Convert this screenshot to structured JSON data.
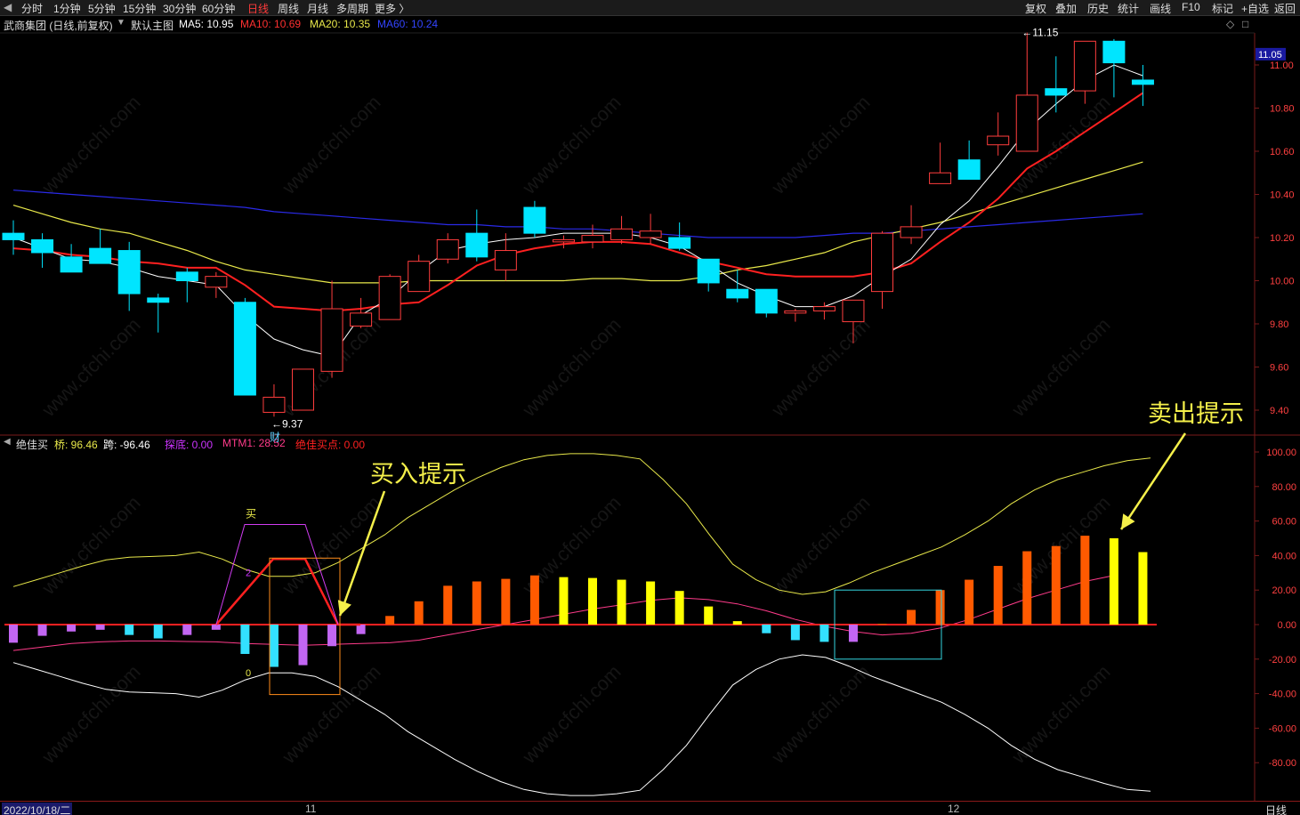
{
  "toolbar": {
    "periods": [
      "分时",
      "1分钟",
      "5分钟",
      "15分钟",
      "30分钟",
      "60分钟",
      "日线",
      "周线",
      "月线",
      "多周期",
      "更多 〉"
    ],
    "active_period": "日线",
    "right_buttons": [
      "复权",
      "叠加",
      "历史",
      "统计",
      "画线",
      "F10",
      "标记",
      "+自选",
      "返回"
    ]
  },
  "main_info": {
    "stock_name": "武商集团 (日线,前复权)",
    "template": "默认主图",
    "ma5": "MA5: 10.95",
    "ma10": "MA10: 10.69",
    "ma20": "MA20: 10.35",
    "ma60": "MA60: 10.24"
  },
  "indicator_info": {
    "name": "绝佳买",
    "qiao": "桥: 96.46",
    "kua": "跨: -96.46",
    "tandi": "探底: 0.00",
    "mtm1": "MTM1: 28.52",
    "buy_point": "绝佳买点: 0.00"
  },
  "annotations": {
    "buy_hint": "买入提示",
    "sell_hint": "卖出提示",
    "cai": "财",
    "low_label": "←9.37",
    "high_label": "←11.15",
    "mai_label": "买",
    "two_label": "2",
    "zero_label": "0"
  },
  "bottom": {
    "date": "2022/10/18/二",
    "month_11": "11",
    "month_12": "12",
    "period": "日线"
  },
  "watermark": "www.cfchi.com",
  "colors": {
    "up": "#ff3d3d",
    "down": "#00e5ff",
    "ma5": "#ffffff",
    "ma10": "#ff2020",
    "ma20": "#e8e84a",
    "ma60": "#2a2ae8",
    "bar_neg": "#c266f2",
    "bar_neg2": "#33e0ff",
    "bar_orange": "#ff5a00",
    "bar_yellow": "#ffff00",
    "grid": "#7a1a1a"
  },
  "chart_data": [
    {
      "type": "candlestick",
      "title": "武商集团 (日线,前复权)",
      "ylim": [
        9.3,
        11.2
      ],
      "yticks": [
        9.4,
        9.6,
        9.8,
        10.0,
        10.2,
        10.4,
        10.6,
        10.8,
        11.0
      ],
      "current_price": 11.05,
      "candles": [
        {
          "o": 10.22,
          "h": 10.28,
          "l": 10.12,
          "c": 10.19
        },
        {
          "o": 10.19,
          "h": 10.22,
          "l": 10.06,
          "c": 10.13
        },
        {
          "o": 10.11,
          "h": 10.17,
          "l": 10.04,
          "c": 10.04
        },
        {
          "o": 10.15,
          "h": 10.24,
          "l": 10.08,
          "c": 10.08
        },
        {
          "o": 10.14,
          "h": 10.18,
          "l": 9.86,
          "c": 9.94
        },
        {
          "o": 9.92,
          "h": 9.94,
          "l": 9.76,
          "c": 9.9
        },
        {
          "o": 10.04,
          "h": 10.06,
          "l": 9.9,
          "c": 10.0
        },
        {
          "o": 9.97,
          "h": 10.04,
          "l": 9.92,
          "c": 10.02
        },
        {
          "o": 9.9,
          "h": 9.92,
          "l": 9.47,
          "c": 9.47
        },
        {
          "o": 9.39,
          "h": 9.52,
          "l": 9.37,
          "c": 9.46
        },
        {
          "o": 9.4,
          "h": 9.59,
          "l": 9.4,
          "c": 9.59
        },
        {
          "o": 9.58,
          "h": 10.0,
          "l": 9.55,
          "c": 9.87
        },
        {
          "o": 9.79,
          "h": 9.92,
          "l": 9.78,
          "c": 9.85
        },
        {
          "o": 9.82,
          "h": 10.03,
          "l": 9.82,
          "c": 10.02
        },
        {
          "o": 9.95,
          "h": 10.12,
          "l": 9.95,
          "c": 10.09
        },
        {
          "o": 10.1,
          "h": 10.22,
          "l": 10.08,
          "c": 10.19
        },
        {
          "o": 10.22,
          "h": 10.33,
          "l": 10.09,
          "c": 10.11
        },
        {
          "o": 10.05,
          "h": 10.22,
          "l": 10.0,
          "c": 10.14
        },
        {
          "o": 10.34,
          "h": 10.37,
          "l": 10.2,
          "c": 10.22
        },
        {
          "o": 10.18,
          "h": 10.21,
          "l": 10.15,
          "c": 10.19
        },
        {
          "o": 10.18,
          "h": 10.26,
          "l": 10.15,
          "c": 10.21
        },
        {
          "o": 10.19,
          "h": 10.3,
          "l": 10.17,
          "c": 10.24
        },
        {
          "o": 10.2,
          "h": 10.31,
          "l": 10.17,
          "c": 10.23
        },
        {
          "o": 10.2,
          "h": 10.27,
          "l": 10.14,
          "c": 10.15
        },
        {
          "o": 10.1,
          "h": 10.1,
          "l": 9.95,
          "c": 9.99
        },
        {
          "o": 9.96,
          "h": 10.05,
          "l": 9.9,
          "c": 9.92
        },
        {
          "o": 9.96,
          "h": 9.96,
          "l": 9.83,
          "c": 9.85
        },
        {
          "o": 9.85,
          "h": 9.87,
          "l": 9.81,
          "c": 9.86
        },
        {
          "o": 9.86,
          "h": 9.9,
          "l": 9.82,
          "c": 9.88
        },
        {
          "o": 9.81,
          "h": 9.91,
          "l": 9.71,
          "c": 9.91
        },
        {
          "o": 9.95,
          "h": 10.23,
          "l": 9.87,
          "c": 10.22
        },
        {
          "o": 10.2,
          "h": 10.35,
          "l": 10.17,
          "c": 10.25
        },
        {
          "o": 10.45,
          "h": 10.64,
          "l": 10.45,
          "c": 10.5
        },
        {
          "o": 10.56,
          "h": 10.65,
          "l": 10.47,
          "c": 10.47
        },
        {
          "o": 10.63,
          "h": 10.78,
          "l": 10.58,
          "c": 10.67
        },
        {
          "o": 10.6,
          "h": 11.15,
          "l": 10.6,
          "c": 10.86
        },
        {
          "o": 10.89,
          "h": 11.04,
          "l": 10.78,
          "c": 10.86
        },
        {
          "o": 10.88,
          "h": 11.11,
          "l": 10.82,
          "c": 11.11
        },
        {
          "o": 11.11,
          "h": 11.12,
          "l": 10.85,
          "c": 11.01
        },
        {
          "o": 10.93,
          "h": 11.0,
          "l": 10.81,
          "c": 10.91
        }
      ],
      "ma5": [
        10.2,
        10.15,
        10.1,
        10.09,
        10.06,
        10.02,
        10.0,
        9.98,
        9.84,
        9.73,
        9.68,
        9.65,
        9.84,
        9.92,
        10.04,
        10.14,
        10.17,
        10.19,
        10.2,
        10.22,
        10.22,
        10.22,
        10.2,
        10.16,
        10.08,
        9.99,
        9.93,
        9.88,
        9.88,
        9.93,
        10.02,
        10.1,
        10.26,
        10.37,
        10.53,
        10.7,
        10.82,
        10.93,
        11.0,
        10.95
      ],
      "ma10": [
        10.15,
        10.14,
        10.12,
        10.11,
        10.09,
        10.08,
        10.06,
        10.06,
        9.98,
        9.88,
        9.87,
        9.86,
        9.87,
        9.89,
        9.9,
        9.98,
        10.07,
        10.12,
        10.15,
        10.17,
        10.18,
        10.18,
        10.17,
        10.13,
        10.09,
        10.06,
        10.03,
        10.02,
        10.02,
        10.02,
        10.04,
        10.08,
        10.18,
        10.27,
        10.38,
        10.52,
        10.6,
        10.69
      ],
      "ma20": [
        10.35,
        10.31,
        10.27,
        10.24,
        10.22,
        10.18,
        10.14,
        10.09,
        10.05,
        10.03,
        10.01,
        9.99,
        9.99,
        9.99,
        10.0,
        10.0,
        10.0,
        10.0,
        10.0,
        10.0,
        10.01,
        10.01,
        10.0,
        10.0,
        10.02,
        10.05,
        10.07,
        10.1,
        10.13,
        10.18,
        10.21,
        10.24,
        10.27,
        10.31,
        10.35
      ],
      "ma60": [
        10.42,
        10.41,
        10.4,
        10.39,
        10.38,
        10.37,
        10.36,
        10.35,
        10.34,
        10.32,
        10.31,
        10.3,
        10.29,
        10.28,
        10.27,
        10.26,
        10.26,
        10.25,
        10.25,
        10.24,
        10.24,
        10.23,
        10.22,
        10.21,
        10.2,
        10.2,
        10.2,
        10.2,
        10.21,
        10.22,
        10.22,
        10.23,
        10.24
      ]
    },
    {
      "type": "bar",
      "title": "绝佳买",
      "ylim": [
        -100,
        100
      ],
      "yticks": [
        100,
        80,
        60,
        40,
        20,
        0,
        -20,
        -40,
        -60,
        -80
      ],
      "bars": [
        {
          "v": -10.5,
          "k": "neg"
        },
        {
          "v": -6.5,
          "k": "neg"
        },
        {
          "v": -4,
          "k": "neg"
        },
        {
          "v": -3,
          "k": "neg"
        },
        {
          "v": -6,
          "k": "neg2"
        },
        {
          "v": -8,
          "k": "neg2"
        },
        {
          "v": -6,
          "k": "neg"
        },
        {
          "v": -3,
          "k": "neg"
        },
        {
          "v": -17,
          "k": "neg2"
        },
        {
          "v": -24.5,
          "k": "neg2"
        },
        {
          "v": -23.5,
          "k": "neg"
        },
        {
          "v": -12.5,
          "k": "neg"
        },
        {
          "v": -5.5,
          "k": "neg"
        },
        {
          "v": 5,
          "k": "orange"
        },
        {
          "v": 13.5,
          "k": "orange"
        },
        {
          "v": 22.5,
          "k": "orange"
        },
        {
          "v": 25,
          "k": "orange"
        },
        {
          "v": 26.5,
          "k": "orange"
        },
        {
          "v": 28.5,
          "k": "orange"
        },
        {
          "v": 27.5,
          "k": "yellow"
        },
        {
          "v": 27,
          "k": "yellow"
        },
        {
          "v": 26,
          "k": "yellow"
        },
        {
          "v": 25,
          "k": "yellow"
        },
        {
          "v": 19.5,
          "k": "yellow"
        },
        {
          "v": 10.5,
          "k": "yellow"
        },
        {
          "v": 2,
          "k": "yellow"
        },
        {
          "v": -5,
          "k": "neg2"
        },
        {
          "v": -9,
          "k": "neg2"
        },
        {
          "v": -10,
          "k": "neg2"
        },
        {
          "v": -10,
          "k": "neg"
        },
        {
          "v": 0.5,
          "k": "orange"
        },
        {
          "v": 8.5,
          "k": "orange"
        },
        {
          "v": 20,
          "k": "orange"
        },
        {
          "v": 26,
          "k": "orange"
        },
        {
          "v": 34,
          "k": "orange"
        },
        {
          "v": 42.5,
          "k": "orange"
        },
        {
          "v": 45.5,
          "k": "orange"
        },
        {
          "v": 51.5,
          "k": "orange"
        },
        {
          "v": 50,
          "k": "yellow"
        },
        {
          "v": 42,
          "k": "yellow"
        }
      ],
      "qiao": [
        22,
        26,
        30,
        34,
        37.5,
        39,
        39.5,
        40,
        42,
        38,
        32,
        28,
        28,
        30,
        36,
        44,
        52,
        62,
        70,
        78,
        85,
        91,
        95.5,
        98,
        99,
        99,
        98,
        96,
        84,
        70,
        52,
        35,
        26,
        20,
        17.5,
        19,
        24,
        30,
        35,
        40,
        45,
        52,
        60,
        70,
        78,
        84,
        88,
        92,
        95,
        96.5
      ],
      "kua": [
        -22,
        -26,
        -30,
        -34,
        -37.5,
        -39,
        -39.5,
        -40,
        -42,
        -38,
        -32,
        -28,
        -28,
        -30,
        -36,
        -44,
        -52,
        -62,
        -70,
        -78,
        -85,
        -91,
        -95.5,
        -98,
        -99,
        -99,
        -98,
        -96,
        -84,
        -70,
        -52,
        -35,
        -26,
        -20,
        -17.5,
        -19,
        -24,
        -30,
        -35,
        -40,
        -45,
        -52,
        -60,
        -70,
        -78,
        -84,
        -88,
        -92,
        -95.5,
        -96.5
      ],
      "mtm1": [
        -15,
        -13,
        -11,
        -10,
        -9.5,
        -9.5,
        -9.8,
        -10,
        -11,
        -11.5,
        -12,
        -11.5,
        -11,
        -10.5,
        -9,
        -6,
        -3,
        0,
        3,
        6,
        9,
        11.5,
        14,
        15.5,
        14.5,
        12,
        8,
        3,
        -1,
        -4,
        -6,
        -5,
        -2,
        3,
        9,
        15,
        20,
        25,
        28.5
      ],
      "buy_signal": [
        0,
        0,
        0,
        0,
        0,
        0,
        0,
        38,
        38,
        38,
        38,
        0
      ],
      "mai_line": [
        0,
        58,
        58,
        0
      ]
    }
  ]
}
